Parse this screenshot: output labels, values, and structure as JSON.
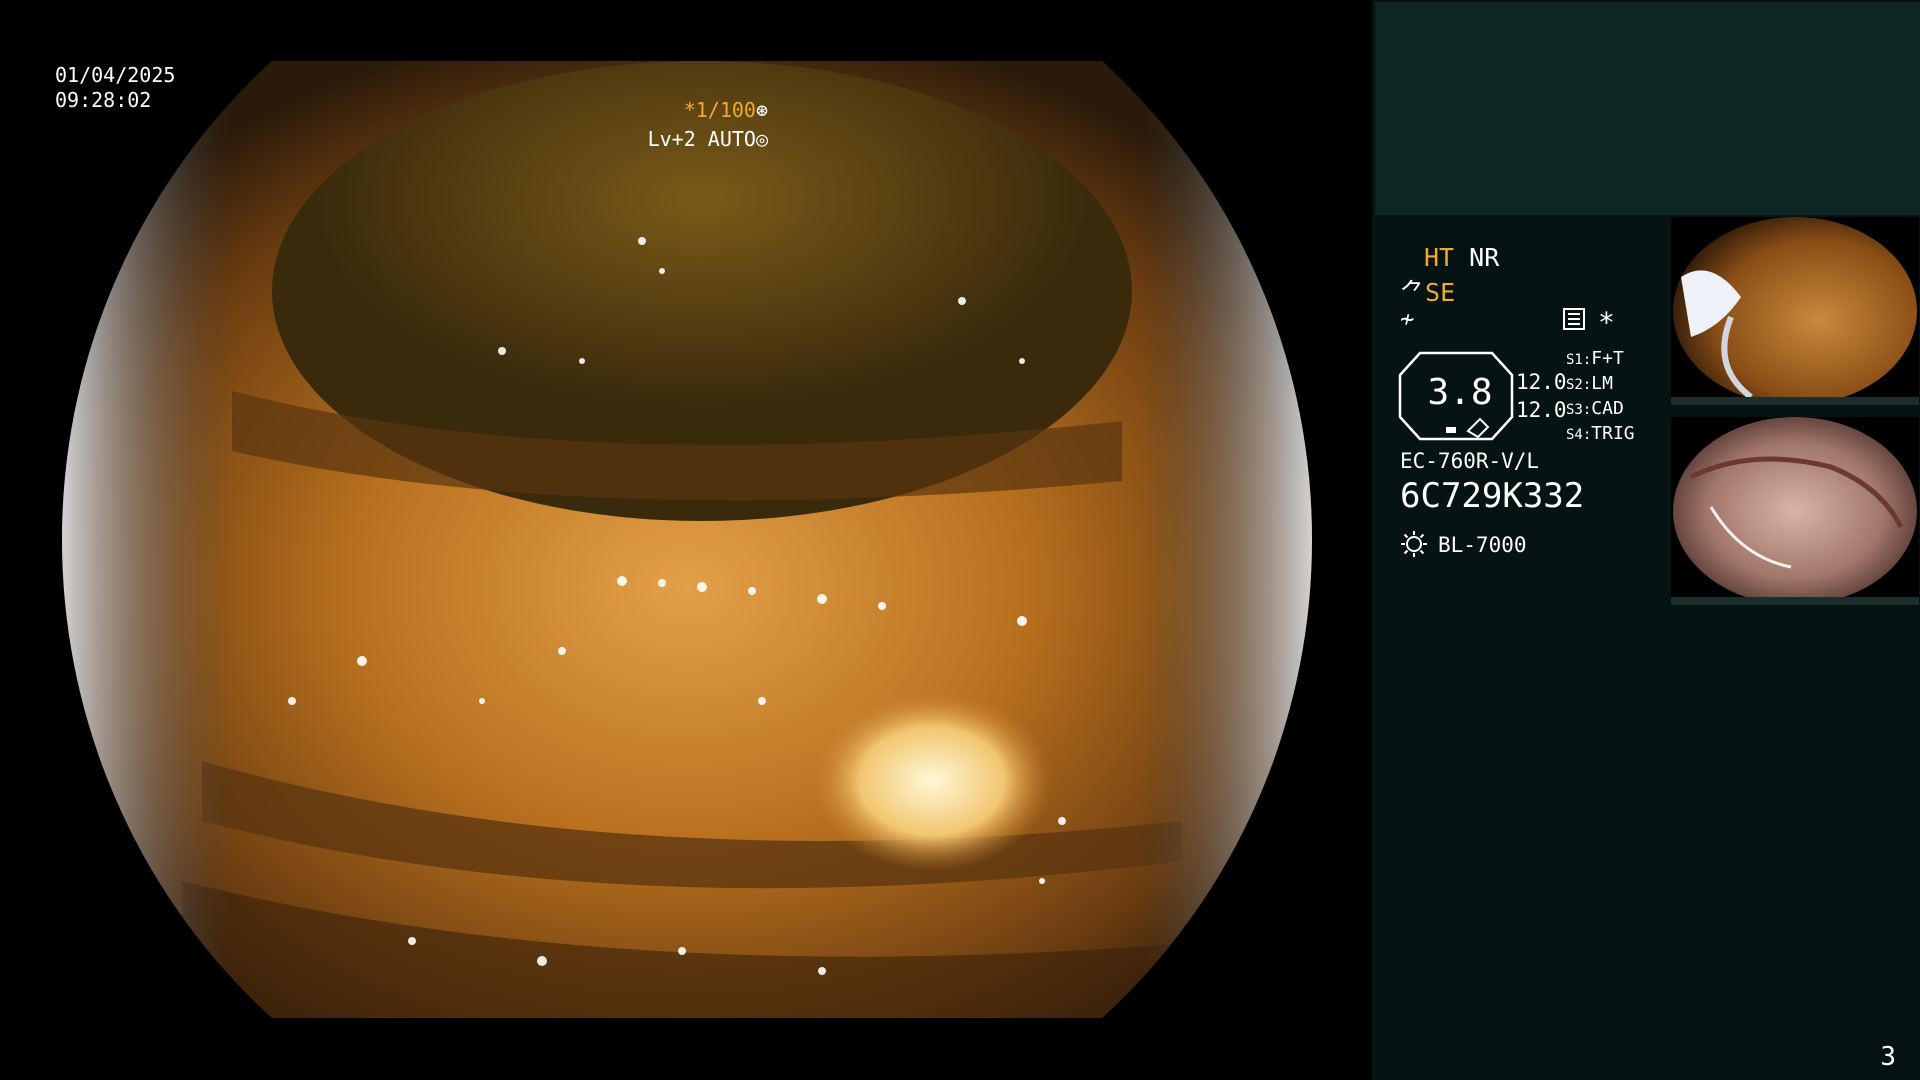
{
  "overlay": {
    "date": "01/04/2025",
    "time": "09:28:02",
    "shutter_star": "*1/100",
    "shutter_icon": "aperture-icon",
    "level": "Lv+2 AUTO",
    "level_icon": "auto-iris-icon"
  },
  "panel": {
    "ht": "HT",
    "nr": "NR",
    "se": "SE",
    "se_icon": "structure-enhancement-icon",
    "slash_icon": "color-mode-icon",
    "menu_icon": "menu-icon",
    "star": "*",
    "gauge_value": "3.8",
    "value_a": "12.0",
    "value_b": "12.0",
    "switches": [
      {
        "key": "S1",
        "value": "F+T"
      },
      {
        "key": "S2",
        "value": "LM"
      },
      {
        "key": "S3",
        "value": "CAD"
      },
      {
        "key": "S4",
        "value": "TRIG"
      }
    ],
    "scope_model": "EC-760R-V/L",
    "scope_serial": "6C729K332",
    "light_icon": "light-source-icon",
    "light_source": "BL-7000",
    "page_number": "3"
  },
  "colors": {
    "accent": "#f0a830",
    "panel_bg": "#051412",
    "panel_top_bg": "#0e2624"
  }
}
